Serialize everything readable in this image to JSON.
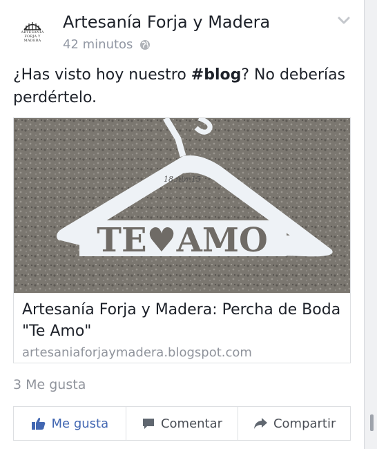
{
  "post": {
    "author": "Artesanía Forja y Madera",
    "logo_lines": [
      "ARTESANÍA",
      "FORJA Y MADERA"
    ],
    "time": "42 minutos",
    "text_before": "¿Has visto hoy nuestro ",
    "text_hashtag": "#blog",
    "text_after": "? No deberías perdértelo."
  },
  "link": {
    "image_text_date": "18.Abr.15",
    "image_text_main": "TE♥AMO",
    "title": "Artesanía Forja y Madera: Percha de Boda \"Te Amo\"",
    "domain": "artesaniaforjaymadera.blogspot.com"
  },
  "stats": {
    "likes": "3 Me gusta"
  },
  "actions": {
    "like": "Me gusta",
    "comment": "Comentar",
    "share": "Compartir"
  },
  "colors": {
    "like_blue": "#4267b2",
    "muted": "#90949c",
    "border": "#dddfe2"
  }
}
